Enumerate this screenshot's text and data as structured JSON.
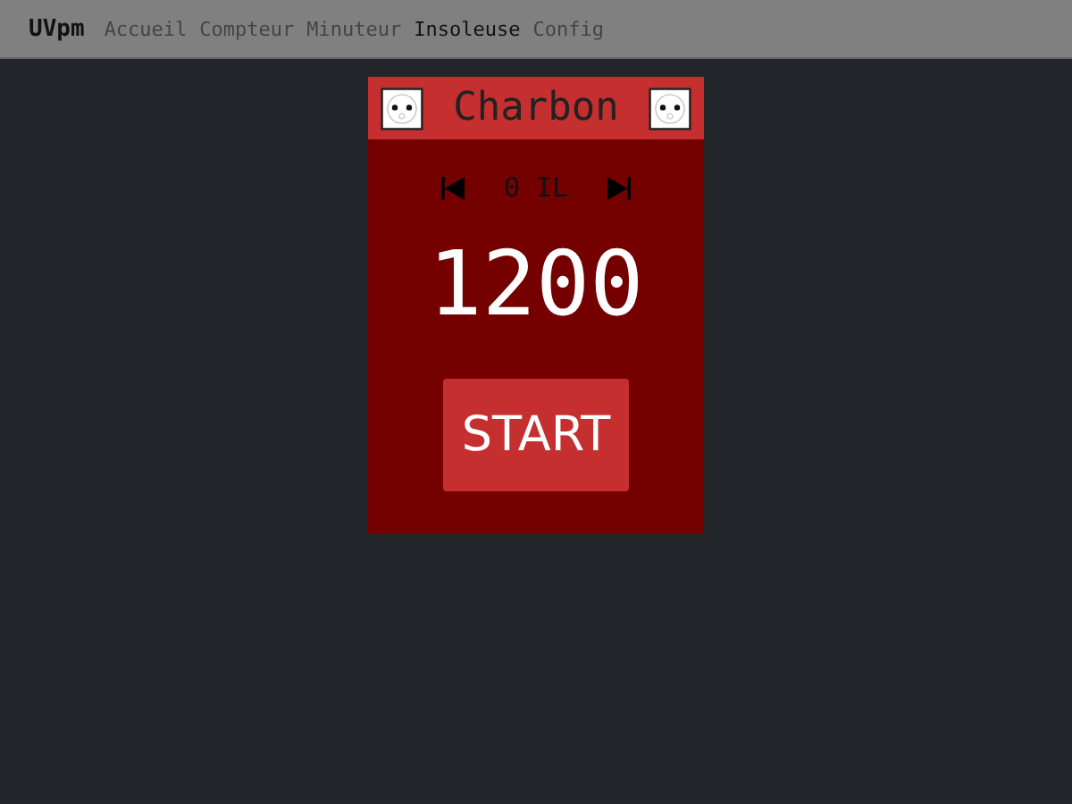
{
  "nav": {
    "brand": "UVpm",
    "items": [
      {
        "label": "Accueil",
        "selected": false
      },
      {
        "label": "Compteur",
        "selected": false
      },
      {
        "label": "Minuteur",
        "selected": false
      },
      {
        "label": "Insoleuse",
        "selected": true
      },
      {
        "label": "Config",
        "selected": false
      }
    ]
  },
  "panel": {
    "title": "Charbon",
    "selector": "0 IL",
    "value": "1200",
    "start": "START"
  }
}
